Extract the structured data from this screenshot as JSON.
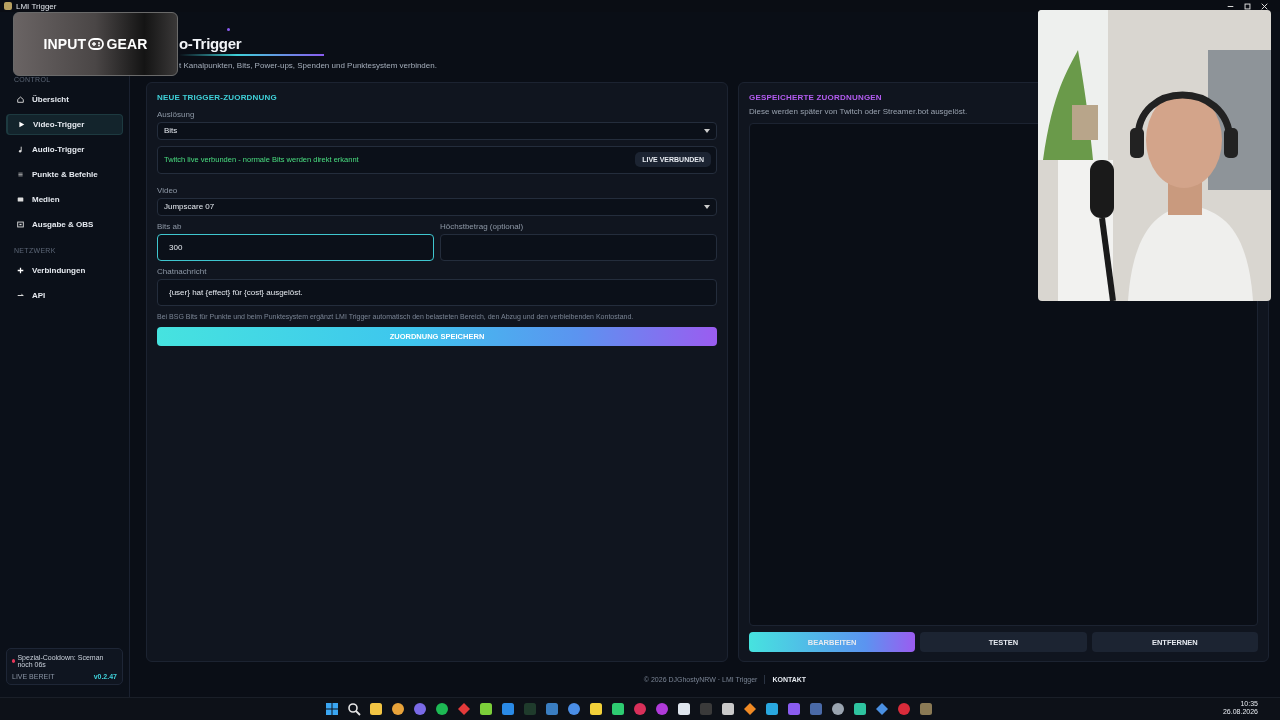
{
  "window": {
    "title": "LMI Trigger"
  },
  "overlay_logo": {
    "left": "INPUT",
    "right": "GEAR"
  },
  "sidebar": {
    "sections": [
      {
        "label": "CONTROL",
        "items": [
          {
            "label": "Übersicht",
            "selected": false
          },
          {
            "label": "Video-Trigger",
            "selected": true
          },
          {
            "label": "Audio-Trigger",
            "selected": false
          },
          {
            "label": "Punkte & Befehle",
            "selected": false
          },
          {
            "label": "Medien",
            "selected": false
          },
          {
            "label": "Ausgabe & OBS",
            "selected": false
          }
        ]
      },
      {
        "label": "NETZWERK",
        "items": [
          {
            "label": "Verbindungen",
            "selected": false
          },
          {
            "label": "API",
            "selected": false
          }
        ]
      }
    ],
    "status_card": {
      "message": "Spezial-Cooldown: Sceman noch 06s",
      "note": "LIVE BEREIT",
      "version": "v0.2.47",
      "color": "#e8365a"
    }
  },
  "header": {
    "title": "o-Trigger",
    "subtitle": "t Kanalpunkten, Bits, Power-ups, Spenden und Punktesystem verbinden."
  },
  "form_panel": {
    "heading": "NEUE TRIGGER-ZUORDNUNG",
    "fields": [
      {
        "kind": "select",
        "label": "Auslösung",
        "value": "Bits"
      },
      {
        "kind": "notice",
        "message": "Twitch live verbunden - normale Bits werden direkt erkannt",
        "badge": "LIVE VERBUNDEN"
      },
      {
        "kind": "select",
        "label": "Video",
        "value": "Jumpscare 07"
      },
      {
        "kind": "pair",
        "fields": [
          {
            "label": "Bits ab",
            "value": "300",
            "focused": true
          },
          {
            "label": "Höchstbetrag (optional)",
            "focused": false
          }
        ]
      },
      {
        "kind": "text",
        "label": "Chatnachricht",
        "value": "{user} hat {effect} für {cost} ausgelöst."
      },
      {
        "kind": "hint",
        "text": "Bei BSG Bits für Punkte und beim Punktesystem ergänzt LMI Trigger automatisch den belasteten Bereich, den Abzug und den verbleibenden Kontostand."
      }
    ],
    "save_button": "ZUORDNUNG SPEICHERN"
  },
  "saved_panel": {
    "heading": "GESPEICHERTE ZUORDNUNGEN",
    "subtitle": "Diese werden später von Twitch oder Streamer.bot ausgelöst.",
    "buttons": [
      {
        "label": "BEARBEITEN",
        "primary": true
      },
      {
        "label": "TESTEN",
        "primary": false
      },
      {
        "label": "ENTFERNEN",
        "primary": false
      }
    ]
  },
  "footer": {
    "copyright": "© 2026 DJGhostyNRW · LMI Trigger",
    "link": "KONTAKT"
  },
  "taskbar": {
    "apps": [
      {
        "kind": "start",
        "color": "#3aa6f2"
      },
      {
        "kind": "search",
        "color": "#e6e6e6"
      },
      {
        "kind": "app",
        "color": "#f2c544"
      },
      {
        "kind": "round",
        "color": "#e8a33a"
      },
      {
        "kind": "round",
        "color": "#7a6ae6"
      },
      {
        "kind": "round",
        "color": "#1db954"
      },
      {
        "kind": "diamond",
        "color": "#e33a3a"
      },
      {
        "kind": "app",
        "color": "#7ccf3a"
      },
      {
        "kind": "app",
        "color": "#2a8ae6"
      },
      {
        "kind": "app",
        "color": "#1f3b2c"
      },
      {
        "kind": "app",
        "color": "#3a7ec2"
      },
      {
        "kind": "round",
        "color": "#4a8ee6"
      },
      {
        "kind": "app",
        "color": "#f2d13a"
      },
      {
        "kind": "app",
        "color": "#2ecc71"
      },
      {
        "kind": "round",
        "color": "#d9305a"
      },
      {
        "kind": "round",
        "color": "#b03ad9"
      },
      {
        "kind": "app",
        "color": "#dfe6ee"
      },
      {
        "kind": "app",
        "color": "#3a3a3a"
      },
      {
        "kind": "app",
        "color": "#c9c9c9"
      },
      {
        "kind": "diamond",
        "color": "#f08a24"
      },
      {
        "kind": "app",
        "color": "#29a8e0"
      },
      {
        "kind": "app",
        "color": "#8a5cf0"
      },
      {
        "kind": "app",
        "color": "#4a6aa8"
      },
      {
        "kind": "round",
        "color": "#9aa4b0"
      },
      {
        "kind": "app",
        "color": "#2ec4a0"
      },
      {
        "kind": "diamond",
        "color": "#4a90e2"
      },
      {
        "kind": "round",
        "color": "#d92b3a"
      },
      {
        "kind": "app",
        "color": "#8a7a55"
      }
    ],
    "time": "10:35",
    "date": "26.08.2026"
  }
}
